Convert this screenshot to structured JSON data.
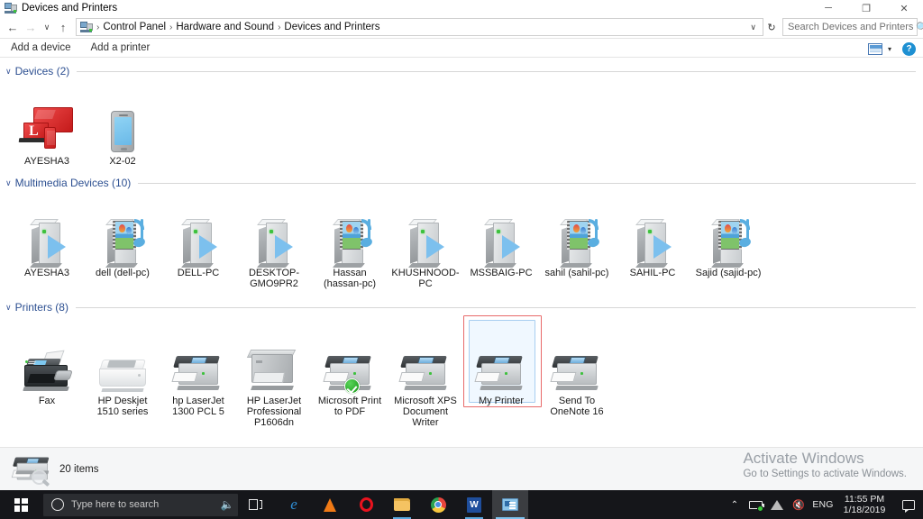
{
  "window": {
    "title": "Devices and Printers",
    "title_icon": "devices-and-printers-icon",
    "minimize": "─",
    "maximize": "❐",
    "close": "✕"
  },
  "address_bar": {
    "back": "←",
    "forward": "→",
    "recent": "∨",
    "up": "↑",
    "breadcrumbs": [
      "Control Panel",
      "Hardware and Sound",
      "Devices and Printers"
    ],
    "separator": "›",
    "dropdown_caret": "∨",
    "refresh": "↻"
  },
  "search": {
    "placeholder": "Search Devices and Printers",
    "value": "",
    "icon": "search-icon"
  },
  "command_bar": {
    "add_device": "Add a device",
    "add_printer": "Add a printer",
    "view_icon": "view-options-icon",
    "view_caret": "▾",
    "help_label": "?"
  },
  "sections": [
    {
      "id": "devices",
      "title": "Devices (2)",
      "chevron": "∨",
      "items": [
        {
          "label": "AYESHA3",
          "icon": "multi-device-icon"
        },
        {
          "label": "X2-02",
          "icon": "mobile-phone-icon"
        }
      ]
    },
    {
      "id": "multimedia-devices",
      "title": "Multimedia Devices (10)",
      "chevron": "∨",
      "items": [
        {
          "label": "AYESHA3",
          "icon": "media-renderer-pc-icon"
        },
        {
          "label": "dell (dell-pc)",
          "icon": "media-server-pc-icon"
        },
        {
          "label": "DELL-PC",
          "icon": "media-renderer-pc-icon"
        },
        {
          "label": "DESKTOP-GMO9PR2",
          "icon": "media-renderer-pc-icon"
        },
        {
          "label": "Hassan (hassan-pc)",
          "icon": "media-server-pc-icon"
        },
        {
          "label": "KHUSHNOOD-PC",
          "icon": "media-renderer-pc-icon"
        },
        {
          "label": "MSSBAIG-PC",
          "icon": "media-renderer-pc-icon"
        },
        {
          "label": "sahil (sahil-pc)",
          "icon": "media-server-pc-icon"
        },
        {
          "label": "SAHIL-PC",
          "icon": "media-renderer-pc-icon"
        },
        {
          "label": "Sajid (sajid-pc)",
          "icon": "media-server-pc-icon"
        }
      ]
    },
    {
      "id": "printers",
      "title": "Printers (8)",
      "chevron": "∨",
      "items": [
        {
          "label": "Fax",
          "icon": "fax-machine-icon",
          "default": false,
          "selected": false
        },
        {
          "label": "HP Deskjet 1510 series",
          "icon": "deskjet-printer-icon",
          "default": false,
          "selected": false
        },
        {
          "label": "hp LaserJet 1300 PCL 5",
          "icon": "laser-printer-icon",
          "default": false,
          "selected": false
        },
        {
          "label": "HP LaserJet Professional P1606dn",
          "icon": "laserjet-pro-printer-icon",
          "default": false,
          "selected": false
        },
        {
          "label": "Microsoft Print to PDF",
          "icon": "laser-printer-icon",
          "default": true,
          "selected": false
        },
        {
          "label": "Microsoft XPS Document Writer",
          "icon": "laser-printer-icon",
          "default": false,
          "selected": false
        },
        {
          "label": "My Printer",
          "icon": "laser-printer-icon",
          "default": false,
          "selected": true
        },
        {
          "label": "Send To OneNote 16",
          "icon": "laser-printer-icon",
          "default": false,
          "selected": false
        }
      ]
    }
  ],
  "status_bar": {
    "icon": "printer-details-icon",
    "item_count": "20 items"
  },
  "watermark": {
    "title": "Activate Windows",
    "subtitle": "Go to Settings to activate Windows."
  },
  "taskbar": {
    "start_icon": "windows-start-icon",
    "search_placeholder": "Type here to search",
    "cortana_icon": "cortana-circle-icon",
    "mic_icon": "microphone-icon",
    "taskview_icon": "task-view-icon",
    "apps": [
      {
        "name": "microsoft-edge-icon",
        "glyph": "e"
      },
      {
        "name": "vlc-media-player-icon",
        "glyph": ""
      },
      {
        "name": "opera-browser-icon",
        "glyph": "O"
      },
      {
        "name": "file-explorer-icon",
        "glyph": ""
      },
      {
        "name": "google-chrome-icon",
        "glyph": ""
      },
      {
        "name": "microsoft-word-icon",
        "glyph": "W"
      },
      {
        "name": "devices-and-printers-taskbar-icon",
        "glyph": ""
      }
    ],
    "tray": {
      "chevron": "⌃",
      "battery_icon": "battery-charging-icon",
      "wifi_icon": "wifi-icon",
      "volume_icon": "volume-muted-icon",
      "language": "ENG",
      "time": "11:55 PM",
      "date": "1/18/2019",
      "notification_icon": "action-center-icon"
    }
  },
  "colors": {
    "section_title": "#2c4f91",
    "selection_border": "#a8cef0",
    "annotation_red": "#e86a6a",
    "accent_blue": "#1e90d2"
  }
}
